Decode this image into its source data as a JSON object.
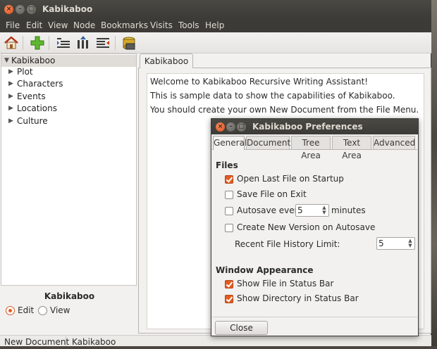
{
  "window": {
    "title": "Kabikaboo",
    "close_glyph": "×",
    "min_glyph": "–",
    "max_glyph": "□"
  },
  "menubar": {
    "items": [
      "File",
      "Edit",
      "View",
      "Node",
      "Bookmarks",
      "Visits",
      "Tools",
      "Help"
    ]
  },
  "toolbar": {
    "buttons": [
      "home-icon",
      "add-icon",
      "indent-icon",
      "move-up-icon",
      "outdent-icon",
      "save-icon"
    ]
  },
  "tree": {
    "root": "Kabikaboo",
    "children": [
      "Plot",
      "Characters",
      "Events",
      "Locations",
      "Culture"
    ]
  },
  "mode": {
    "label": "Kabikaboo",
    "options": [
      "Edit",
      "View"
    ],
    "selected": "Edit"
  },
  "notebook": {
    "tab_label": "Kabikaboo",
    "lines": [
      "Welcome to Kabikaboo Recursive Writing Assistant!",
      "This is sample data to show the capabilities of Kabikaboo.",
      "You should create your own New Document from the File Menu."
    ]
  },
  "statusbar": {
    "file": "New Document",
    "directory": "Kabikaboo"
  },
  "preferences": {
    "title": "Kabikaboo Preferences",
    "tabs": [
      "General",
      "Document",
      "Tree Area",
      "Text Area",
      "Advanced"
    ],
    "active_tab": "General",
    "files_section": "Files",
    "open_last_file": {
      "label": "Open Last File on Startup",
      "checked": true
    },
    "save_on_exit": {
      "label": "Save File on Exit",
      "checked": false
    },
    "autosave": {
      "label": "Autosave every",
      "value": "5",
      "unit": "minutes",
      "checked": false
    },
    "new_version": {
      "label": "Create New Version on Autosave",
      "checked": false
    },
    "history_limit": {
      "label": "Recent File History Limit:",
      "value": "5"
    },
    "window_section": "Window Appearance",
    "show_file": {
      "label": "Show File in Status Bar",
      "checked": true
    },
    "show_directory": {
      "label": "Show Directory in Status Bar",
      "checked": true
    },
    "close_label": "Close"
  },
  "colors": {
    "accent": "#e05c20",
    "titlebar": "#3c3b37"
  }
}
